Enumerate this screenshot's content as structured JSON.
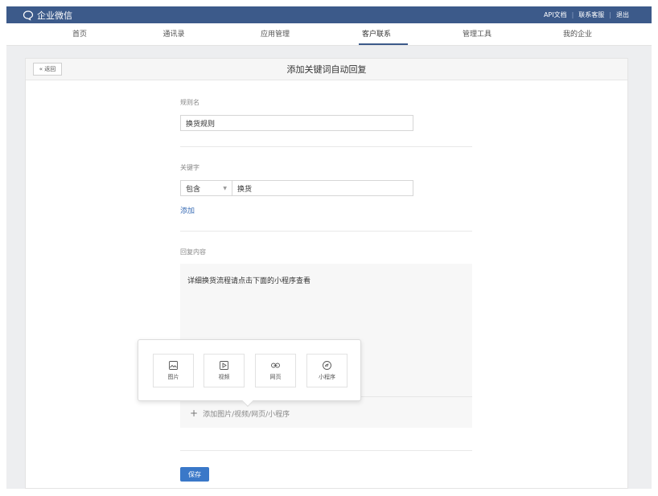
{
  "topbar": {
    "brand": "企业微信",
    "links": [
      "API文档",
      "联系客服",
      "退出"
    ]
  },
  "nav": {
    "items": [
      "首页",
      "通讯录",
      "应用管理",
      "客户联系",
      "管理工具",
      "我的企业"
    ],
    "active_index": 3
  },
  "header": {
    "back_label": "« 返回",
    "title": "添加关键词自动回复"
  },
  "form": {
    "rule_name_label": "规则名",
    "rule_name_value": "换货规则",
    "keyword_label": "关键字",
    "match_mode": "包含",
    "keyword_value": "换货",
    "add_link": "添加",
    "reply_label": "回复内容",
    "reply_text": "详细换货流程请点击下面的小程序查看",
    "add_media_label": "添加图片/视频/网页/小程序",
    "media_options": [
      "图片",
      "视频",
      "网页",
      "小程序"
    ],
    "save_label": "保存"
  },
  "colors": {
    "topbar": "#3c5a8a",
    "primary_button": "#3a78c8",
    "link": "#3a6cb5",
    "background": "#edeef0"
  },
  "icons": [
    "chat-bubble-icon",
    "caret-down-icon",
    "plus-icon",
    "image-icon",
    "video-icon",
    "link-icon",
    "mini-program-icon"
  ]
}
